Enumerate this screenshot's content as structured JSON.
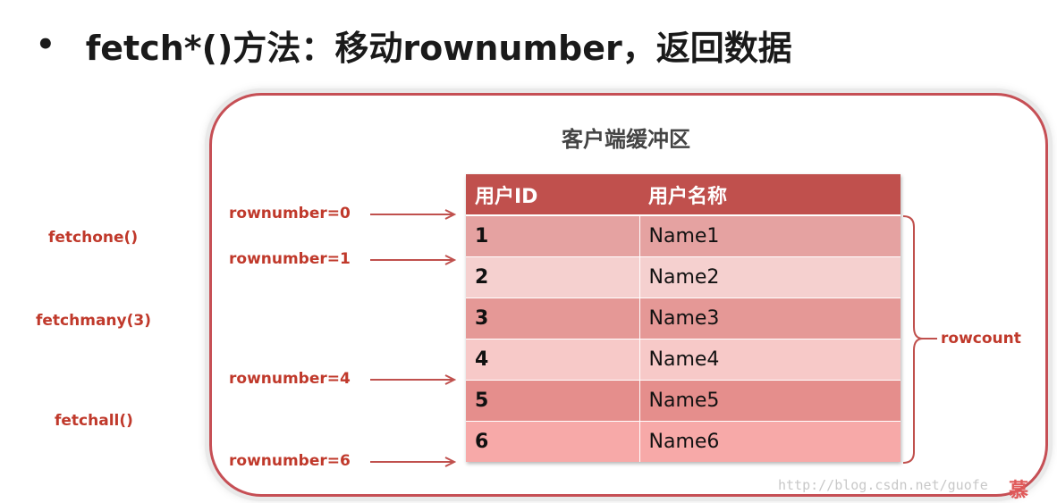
{
  "heading": {
    "bullet": "•",
    "text": "fetch*()方法：移动rownumber，返回数据"
  },
  "buffer": {
    "title": "客户端缓冲区"
  },
  "table": {
    "headers": [
      "用户ID",
      "用户名称"
    ],
    "rows": [
      {
        "id": "1",
        "name": "Name1"
      },
      {
        "id": "2",
        "name": "Name2"
      },
      {
        "id": "3",
        "name": "Name3"
      },
      {
        "id": "4",
        "name": "Name4"
      },
      {
        "id": "5",
        "name": "Name5"
      },
      {
        "id": "6",
        "name": "Name6"
      }
    ]
  },
  "pointers": [
    "rownumber=0",
    "rownumber=1",
    "rownumber=4",
    "rownumber=6"
  ],
  "methods": [
    "fetchone()",
    "fetchmany(3)",
    "fetchall()"
  ],
  "rowcount_label": "rowcount",
  "watermark": "http://blog.csdn.net/guofe",
  "colors": {
    "accent": "#c0504d",
    "label_red": "#c0392b",
    "panel_border": "#c64f55"
  }
}
